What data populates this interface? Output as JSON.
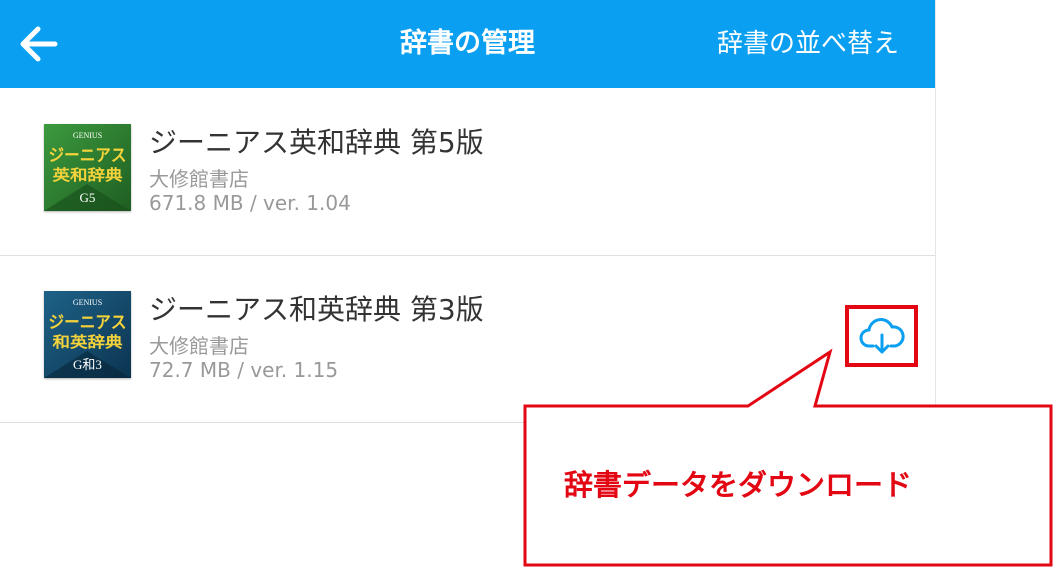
{
  "header": {
    "title": "辞書の管理",
    "sort_label": "辞書の並べ替え",
    "back_icon": "arrow-left-icon",
    "color": "#0a9ff0"
  },
  "dictionaries": [
    {
      "name": "ジーニアス英和辞典 第5版",
      "publisher": "大修館書店",
      "meta": "671.8 MB / ver. 1.04",
      "cover": {
        "brand": "GENIUS",
        "line1": "ジーニアス",
        "line2": "英和辞典",
        "code": "G5",
        "color": "#2f7d32",
        "text_color": "#f5d33a"
      }
    },
    {
      "name": "ジーニアス和英辞典 第3版",
      "publisher": "大修館書店",
      "meta": "72.7 MB / ver. 1.15",
      "cover": {
        "brand": "GENIUS",
        "line1": "ジーニアス",
        "line2": "和英辞典",
        "code": "G和3",
        "color": "#164a6b",
        "text_color": "#f5d33a"
      }
    }
  ],
  "download": {
    "icon": "cloud-download-icon",
    "color": "#0a9ff0"
  },
  "callout": {
    "text": "辞書データをダウンロード",
    "color": "#e30613"
  }
}
